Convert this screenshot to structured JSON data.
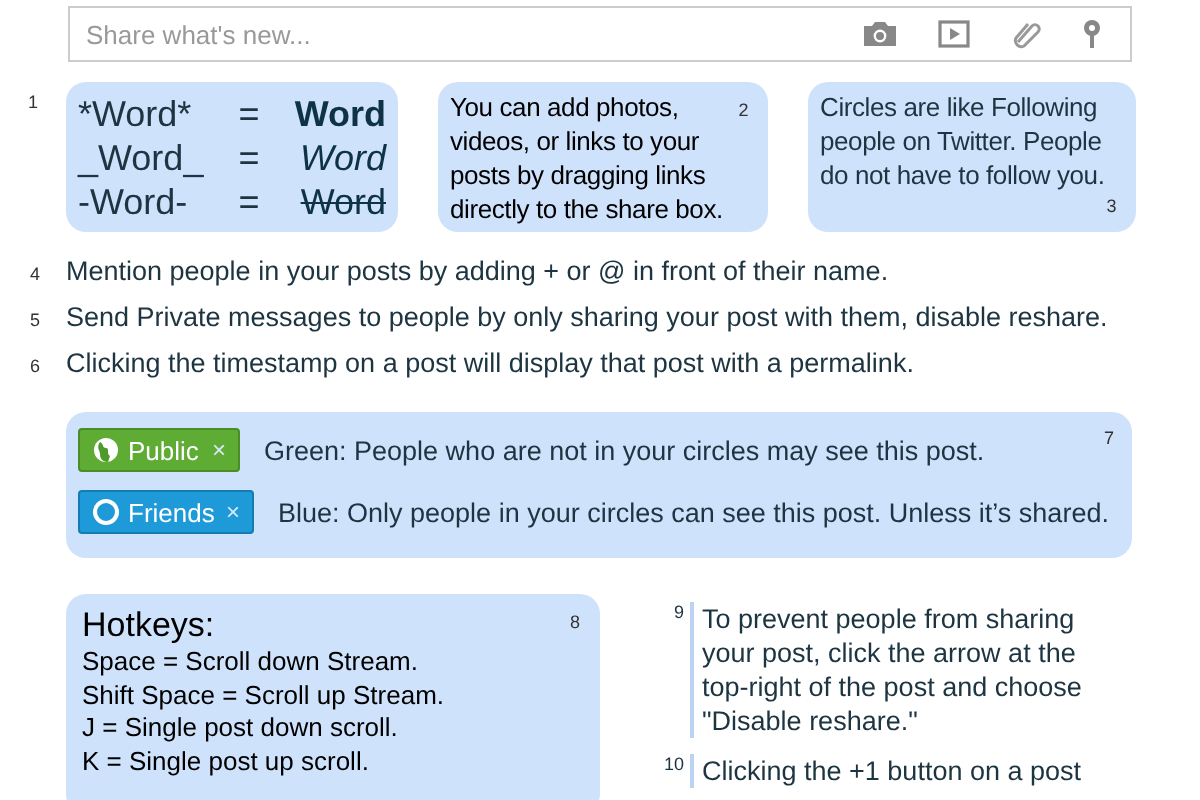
{
  "share_box": {
    "placeholder": "Share what's new..."
  },
  "formatting_tip": {
    "number": "1",
    "rows": [
      {
        "kind": "bold",
        "markup": "*Word*",
        "equals": "=",
        "result": "Word"
      },
      {
        "kind": "italic",
        "markup": "_Word_",
        "equals": "=",
        "result": "Word"
      },
      {
        "kind": "strike",
        "markup": "-Word-",
        "equals": "=",
        "result": "Word"
      }
    ]
  },
  "top_tips": [
    {
      "number": "2",
      "text": "You can add photos, videos, or links to your posts by dragging links directly to the share box."
    },
    {
      "number": "3",
      "text": "Circles are like Following people on Twitter. People do not have to follow you."
    }
  ],
  "list_tips": [
    {
      "number": "4",
      "text": "Mention people in your posts by adding + or @ in front of their name."
    },
    {
      "number": "5",
      "text": "Send Private messages to people by only sharing your post with them, disable reshare."
    },
    {
      "number": "6",
      "text": "Clicking the timestamp on a post will display that post with a permalink."
    }
  ],
  "visibility_tip": {
    "number": "7",
    "rows": [
      {
        "kind": "public",
        "chip": "Public",
        "close": "×",
        "text": "Green: People who are not in your circles may see this post."
      },
      {
        "kind": "circle",
        "chip": "Friends",
        "close": "×",
        "text": "Blue: Only people in your circles can see this post. Unless it’s shared."
      }
    ]
  },
  "hotkeys": {
    "number": "8",
    "title": "Hotkeys:",
    "lines": [
      "Space = Scroll down Stream.",
      "Shift Space = Scroll up Stream.",
      "J = Single post down scroll.",
      "K = Single post up scroll."
    ]
  },
  "side_tips": [
    {
      "number": "9",
      "text": "To prevent people from sharing your post, click the arrow at the top-right of the post and choose \"Disable reshare.\""
    },
    {
      "number": "10",
      "text": "Clicking the +1 button on a post"
    }
  ]
}
